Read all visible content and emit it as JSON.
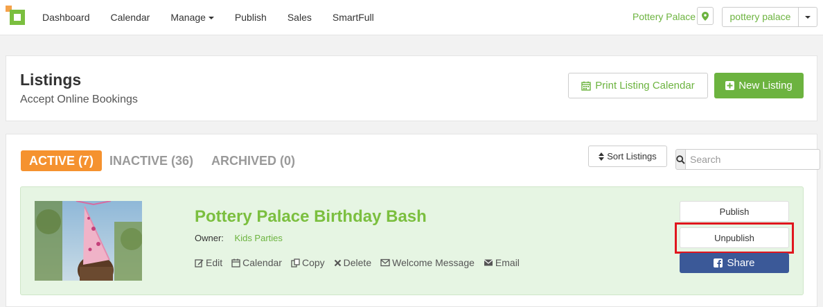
{
  "nav": {
    "items": [
      {
        "label": "Dashboard"
      },
      {
        "label": "Calendar"
      },
      {
        "label": "Manage",
        "has_dropdown": true
      },
      {
        "label": "Publish"
      },
      {
        "label": "Sales"
      },
      {
        "label": "SmartFull"
      }
    ],
    "store_name": "Pottery Palace",
    "account_value": "pottery palace"
  },
  "header": {
    "title": "Listings",
    "subtitle": "Accept Online Bookings",
    "print_label": "Print Listing Calendar",
    "new_label": "New Listing"
  },
  "tabs": {
    "active": "ACTIVE (7)",
    "inactive": "INACTIVE (36)",
    "archived": "ARCHIVED (0)"
  },
  "toolbar": {
    "sort_label": "Sort Listings",
    "search_placeholder": "Search"
  },
  "listing": {
    "title": "Pottery Palace Birthday Bash",
    "owner_label": "Owner:",
    "owner_value": "Kids Parties",
    "actions": {
      "edit": "Edit",
      "calendar": "Calendar",
      "copy": "Copy",
      "delete": "Delete",
      "welcome": "Welcome Message",
      "email": "Email"
    },
    "publish_label": "Publish",
    "unpublish_label": "Unpublish",
    "share_label": "Share"
  },
  "colors": {
    "brand_green": "#6cb33f",
    "tab_orange": "#f5922f",
    "highlight_red": "#e0161e",
    "facebook_blue": "#3b5998",
    "card_bg": "#e6f5e3"
  }
}
